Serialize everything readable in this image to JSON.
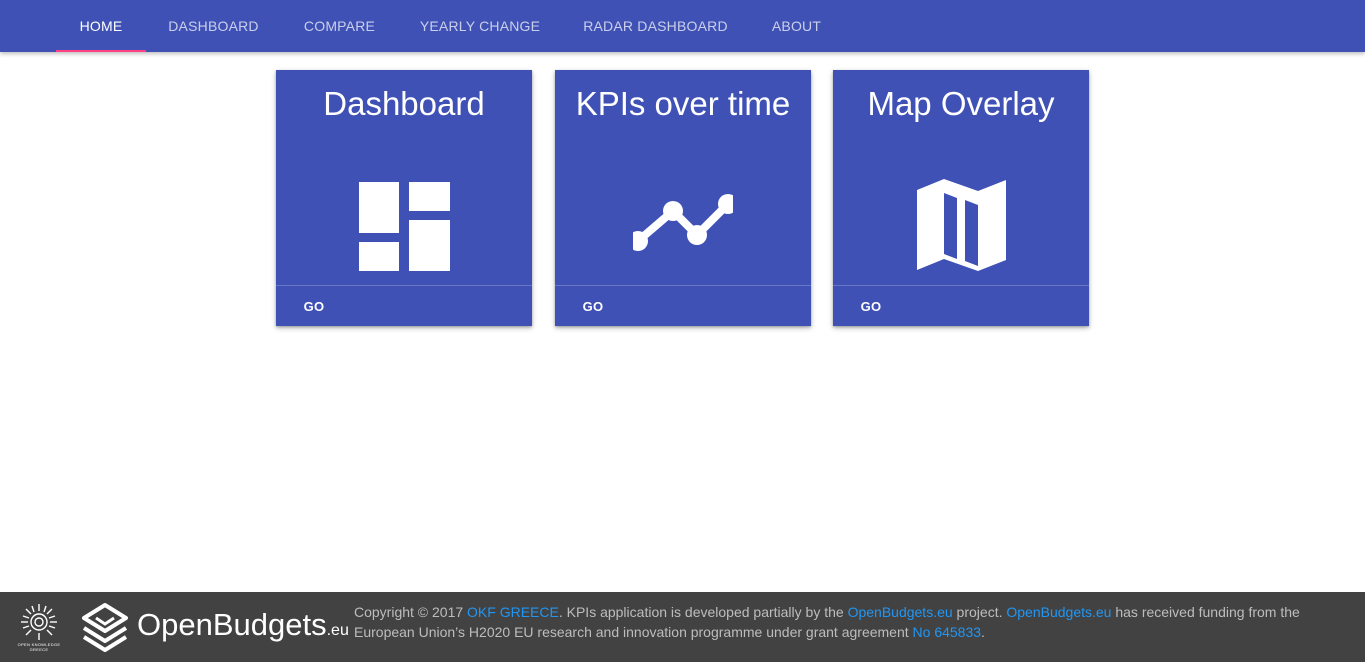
{
  "nav": {
    "tabs": [
      {
        "label": "HOME",
        "active": true
      },
      {
        "label": "DASHBOARD",
        "active": false
      },
      {
        "label": "COMPARE",
        "active": false
      },
      {
        "label": "YEARLY CHANGE",
        "active": false
      },
      {
        "label": "RADAR DASHBOARD",
        "active": false
      },
      {
        "label": "ABOUT",
        "active": false
      }
    ]
  },
  "cards": [
    {
      "title": "Dashboard",
      "icon": "dashboard-icon",
      "action": "GO"
    },
    {
      "title": "KPIs over time",
      "icon": "timeline-icon",
      "action": "GO"
    },
    {
      "title": "Map Overlay",
      "icon": "map-icon",
      "action": "GO"
    }
  ],
  "footer": {
    "okf_logo_text": "OPEN KNOWLEDGE GREECE",
    "brand_name": "OpenBudgets",
    "brand_suffix": ".eu",
    "text_1": "Copyright © 2017 ",
    "link_okf": "OKF GREECE",
    "text_2": ". KPIs application is developed partially by the ",
    "link_ob1": "OpenBudgets.eu",
    "text_3": " project. ",
    "link_ob2": "OpenBudgets.eu",
    "text_4": " has received funding from the European Union’s H2020 EU research and innovation programme under grant agreement ",
    "link_grant": "No 645833",
    "text_5": "."
  },
  "colors": {
    "primary": "#3f51b5",
    "accent": "#ff4081",
    "footer_bg": "#424242",
    "link": "#2196f3"
  }
}
